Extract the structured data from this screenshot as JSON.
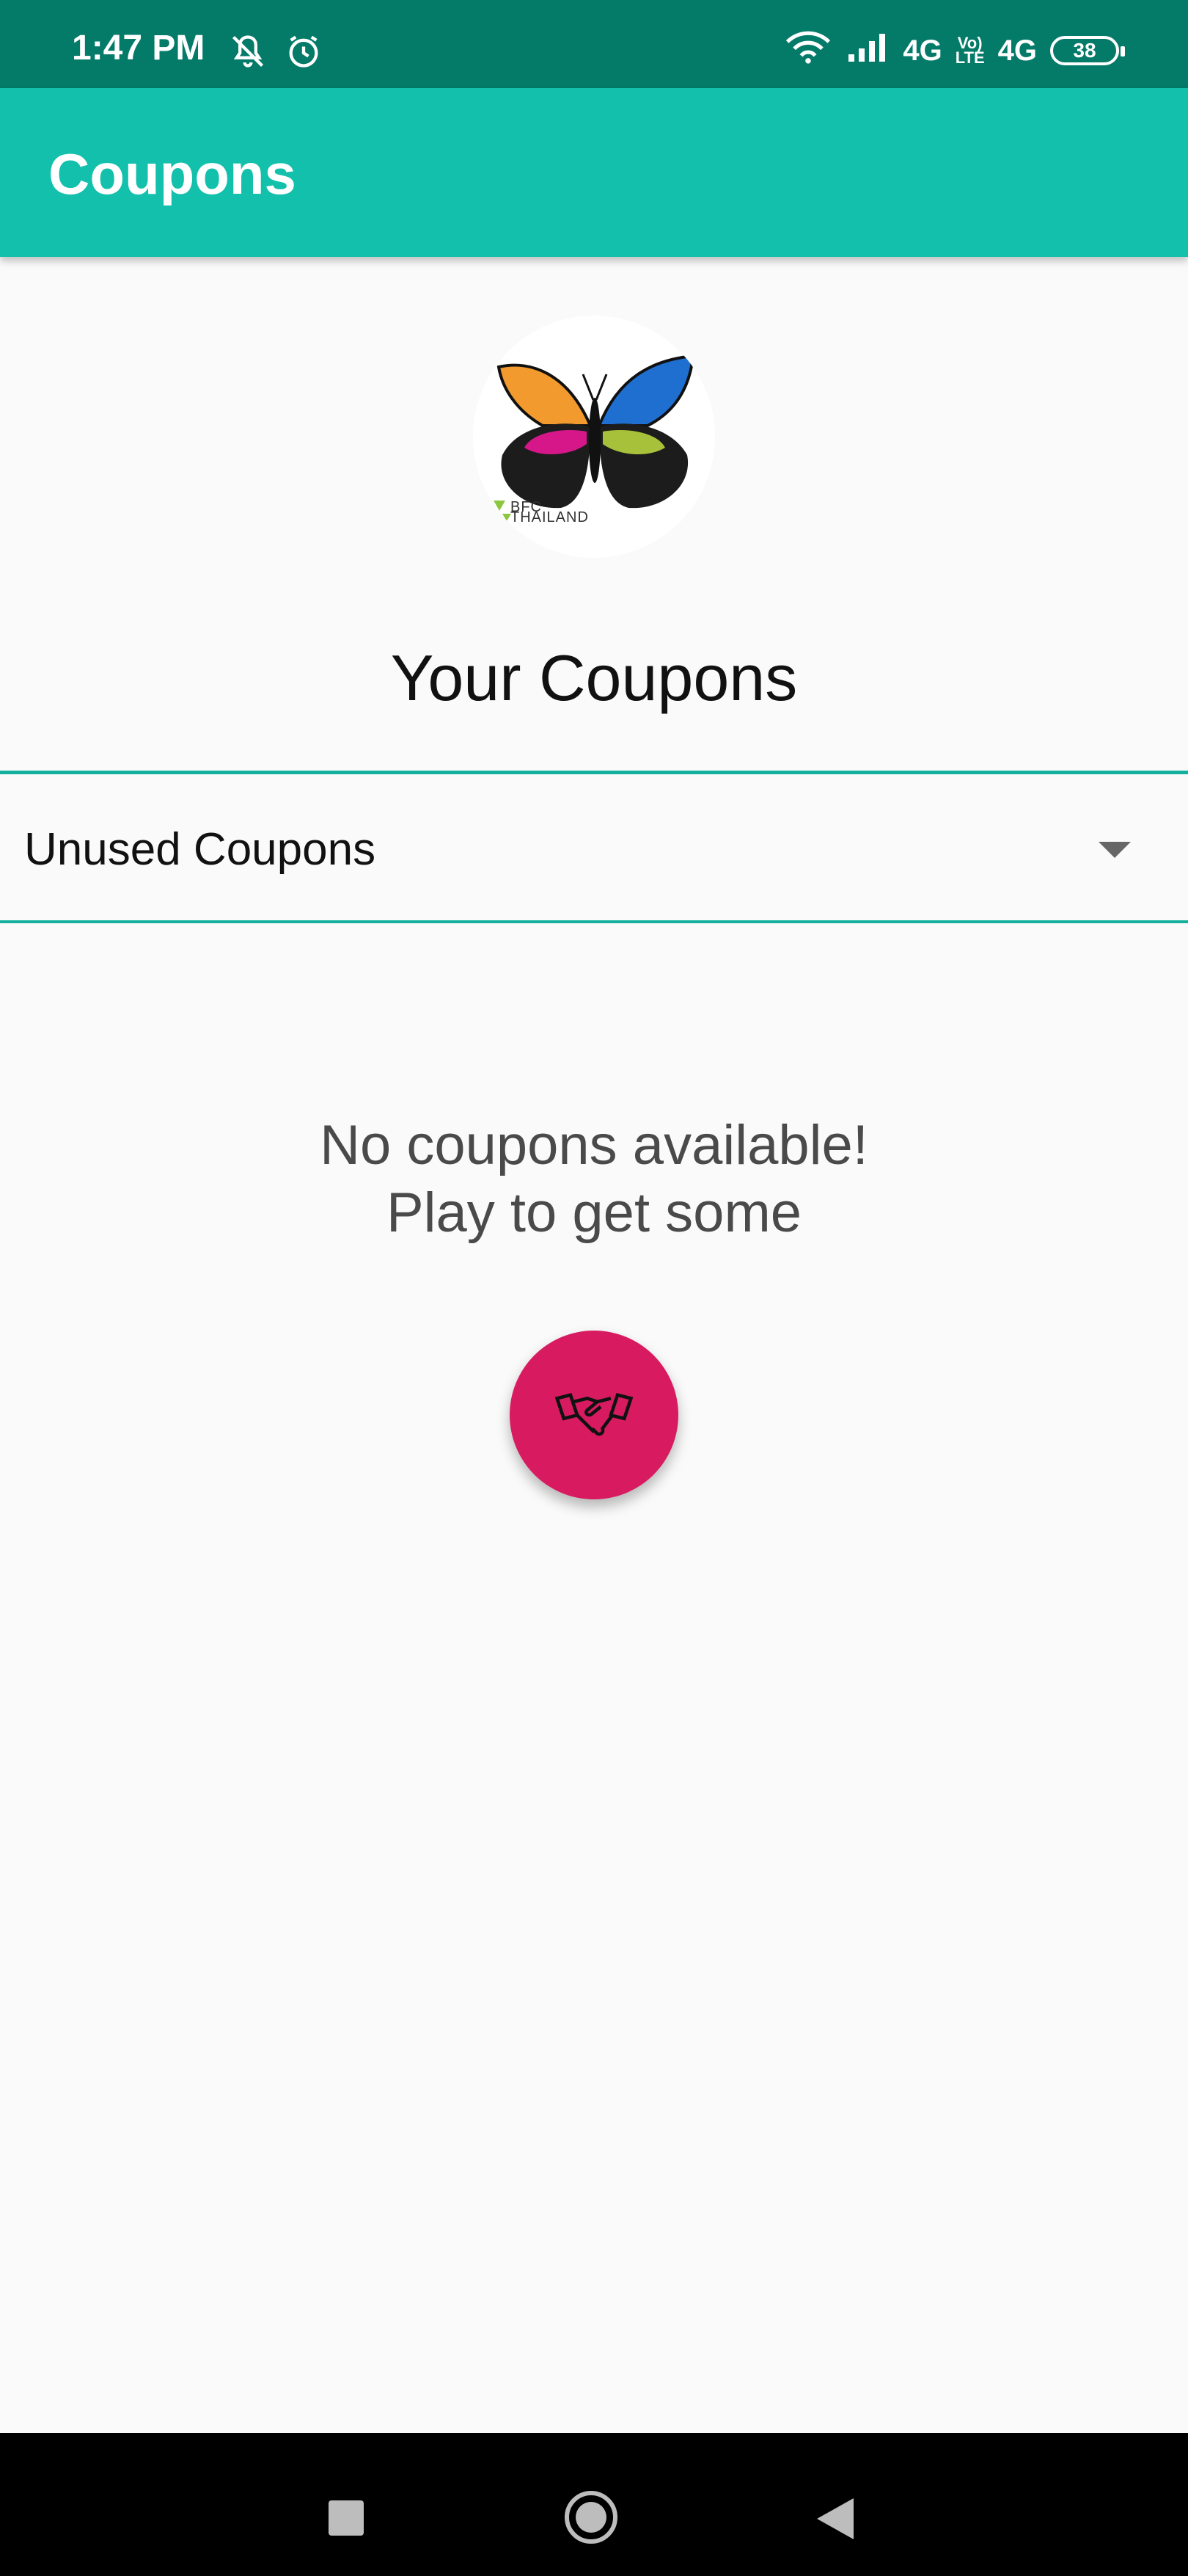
{
  "status_bar": {
    "time": "1:47 PM",
    "network_1": "4G",
    "volte_top": "Vo)",
    "volte_bottom": "LTE",
    "network_2": "4G",
    "battery": "38"
  },
  "app_bar": {
    "title": "Coupons"
  },
  "logo": {
    "text_line1": "BFC",
    "text_line2": "THAILAND",
    "wing_colors": [
      "#f29a2e",
      "#1f6fd1",
      "#d6178a",
      "#a7c23a"
    ]
  },
  "main": {
    "heading": "Your Coupons",
    "dropdown": {
      "selected": "Unused Coupons"
    },
    "empty_line1": "No coupons available!",
    "empty_line2": "Play to get some",
    "fab_icon": "handshake-icon"
  },
  "nav_bar": {
    "icons": [
      "recents-square-icon",
      "home-circle-icon",
      "back-triangle-icon"
    ]
  },
  "colors": {
    "status_bar": "#047a69",
    "app_bar": "#13c0ac",
    "accent_line": "#13b09d",
    "fab": "#d81b60"
  }
}
